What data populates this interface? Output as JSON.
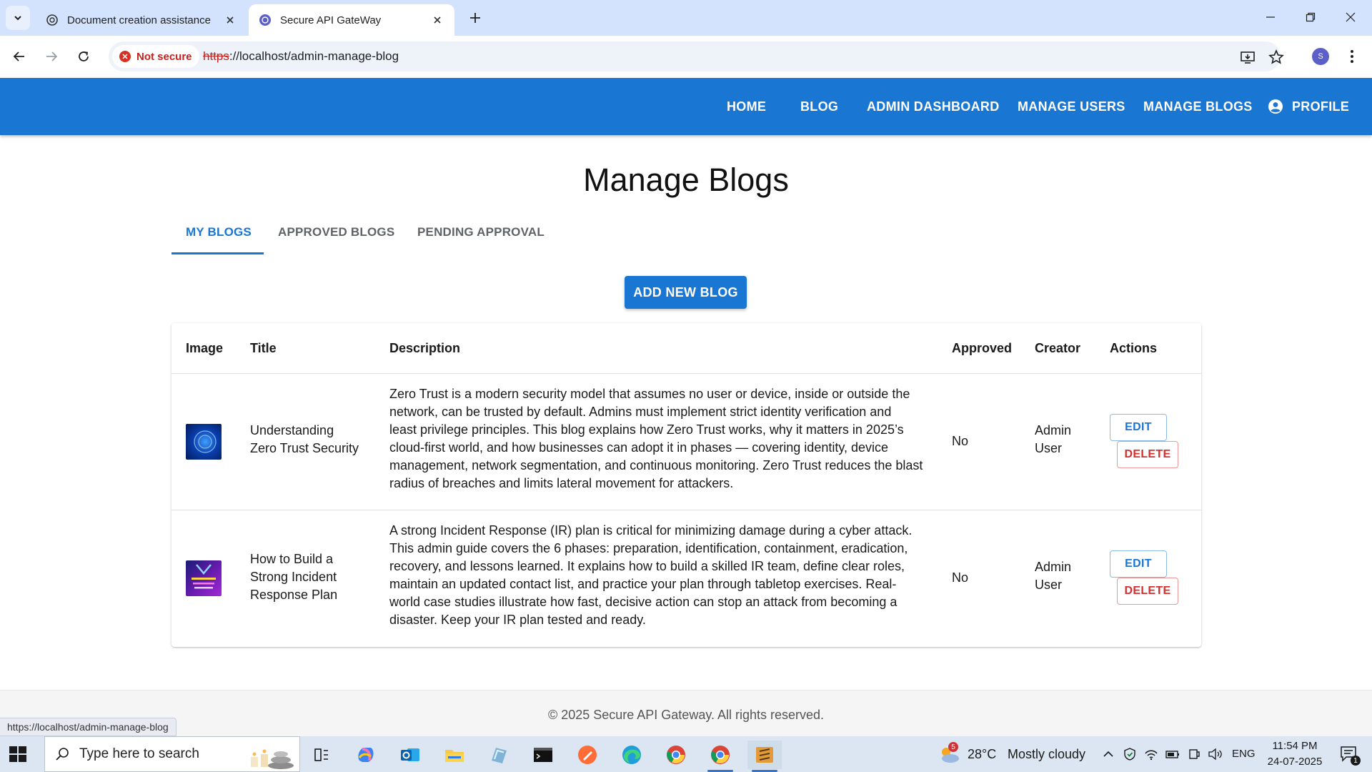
{
  "browser": {
    "tabs": [
      {
        "title": "Document creation assistance",
        "active": false
      },
      {
        "title": "Secure API GateWay",
        "active": true
      }
    ],
    "security_label": "Not secure",
    "url_scheme": "https",
    "url_rest": "://localhost/admin-manage-blog",
    "profile_initial": "S",
    "status_url": "https://localhost/admin-manage-blog"
  },
  "appbar": {
    "links": [
      "HOME",
      "BLOG",
      "ADMIN DASHBOARD",
      "MANAGE USERS",
      "MANAGE BLOGS"
    ],
    "profile_label": "PROFILE"
  },
  "page": {
    "title": "Manage Blogs",
    "tabs": [
      "MY BLOGS",
      "APPROVED BLOGS",
      "PENDING APPROVAL"
    ],
    "active_tab": "MY BLOGS",
    "add_button": "ADD NEW BLOG"
  },
  "table": {
    "headers": [
      "Image",
      "Title",
      "Description",
      "Approved",
      "Creator",
      "Actions"
    ],
    "rows": [
      {
        "title_lines": [
          "Understanding",
          "Zero Trust Security"
        ],
        "description_lines": [
          "Zero Trust is a modern security model that assumes no user or device, inside or outside the",
          "network, can be trusted by default. Admins must implement strict identity verification and",
          "least privilege principles. This blog explains how Zero Trust works, why it matters in 2025’s",
          "cloud-first world, and how businesses can adopt it in phases — covering identity, device",
          "management, network segmentation, and continuous monitoring. Zero Trust reduces the blast",
          "radius of breaches and limits lateral movement for attackers."
        ],
        "approved": "No",
        "creator_lines": [
          "Admin",
          "User"
        ],
        "edit": "EDIT",
        "delete": "DELETE"
      },
      {
        "title_lines": [
          "How to Build a",
          "Strong Incident",
          "Response Plan"
        ],
        "description_lines": [
          "A strong Incident Response (IR) plan is critical for minimizing damage during a cyber attack.",
          "This admin guide covers the 6 phases: preparation, identification, containment, eradication,",
          "recovery, and lessons learned. It explains how to build a skilled IR team, define clear roles,",
          "maintain an updated contact list, and practice your plan through tabletop exercises. Real-",
          "world case studies illustrate how fast, decisive action can stop an attack from becoming a",
          "disaster. Keep your IR plan tested and ready."
        ],
        "approved": "No",
        "creator_lines": [
          "Admin",
          "User"
        ],
        "edit": "EDIT",
        "delete": "DELETE"
      }
    ]
  },
  "footer": {
    "text": "© 2025 Secure API Gateway. All rights reserved."
  },
  "taskbar": {
    "search_placeholder": "Type here to search",
    "weather_badge": "5",
    "temperature": "28°C",
    "weather": "Mostly cloudy",
    "language": "ENG",
    "time": "11:54 PM",
    "date": "24-07-2025",
    "notification_count": "1"
  },
  "colors": {
    "primary": "#1976d2",
    "danger": "#d32f2f",
    "tabstrip": "#d3e3fd"
  }
}
